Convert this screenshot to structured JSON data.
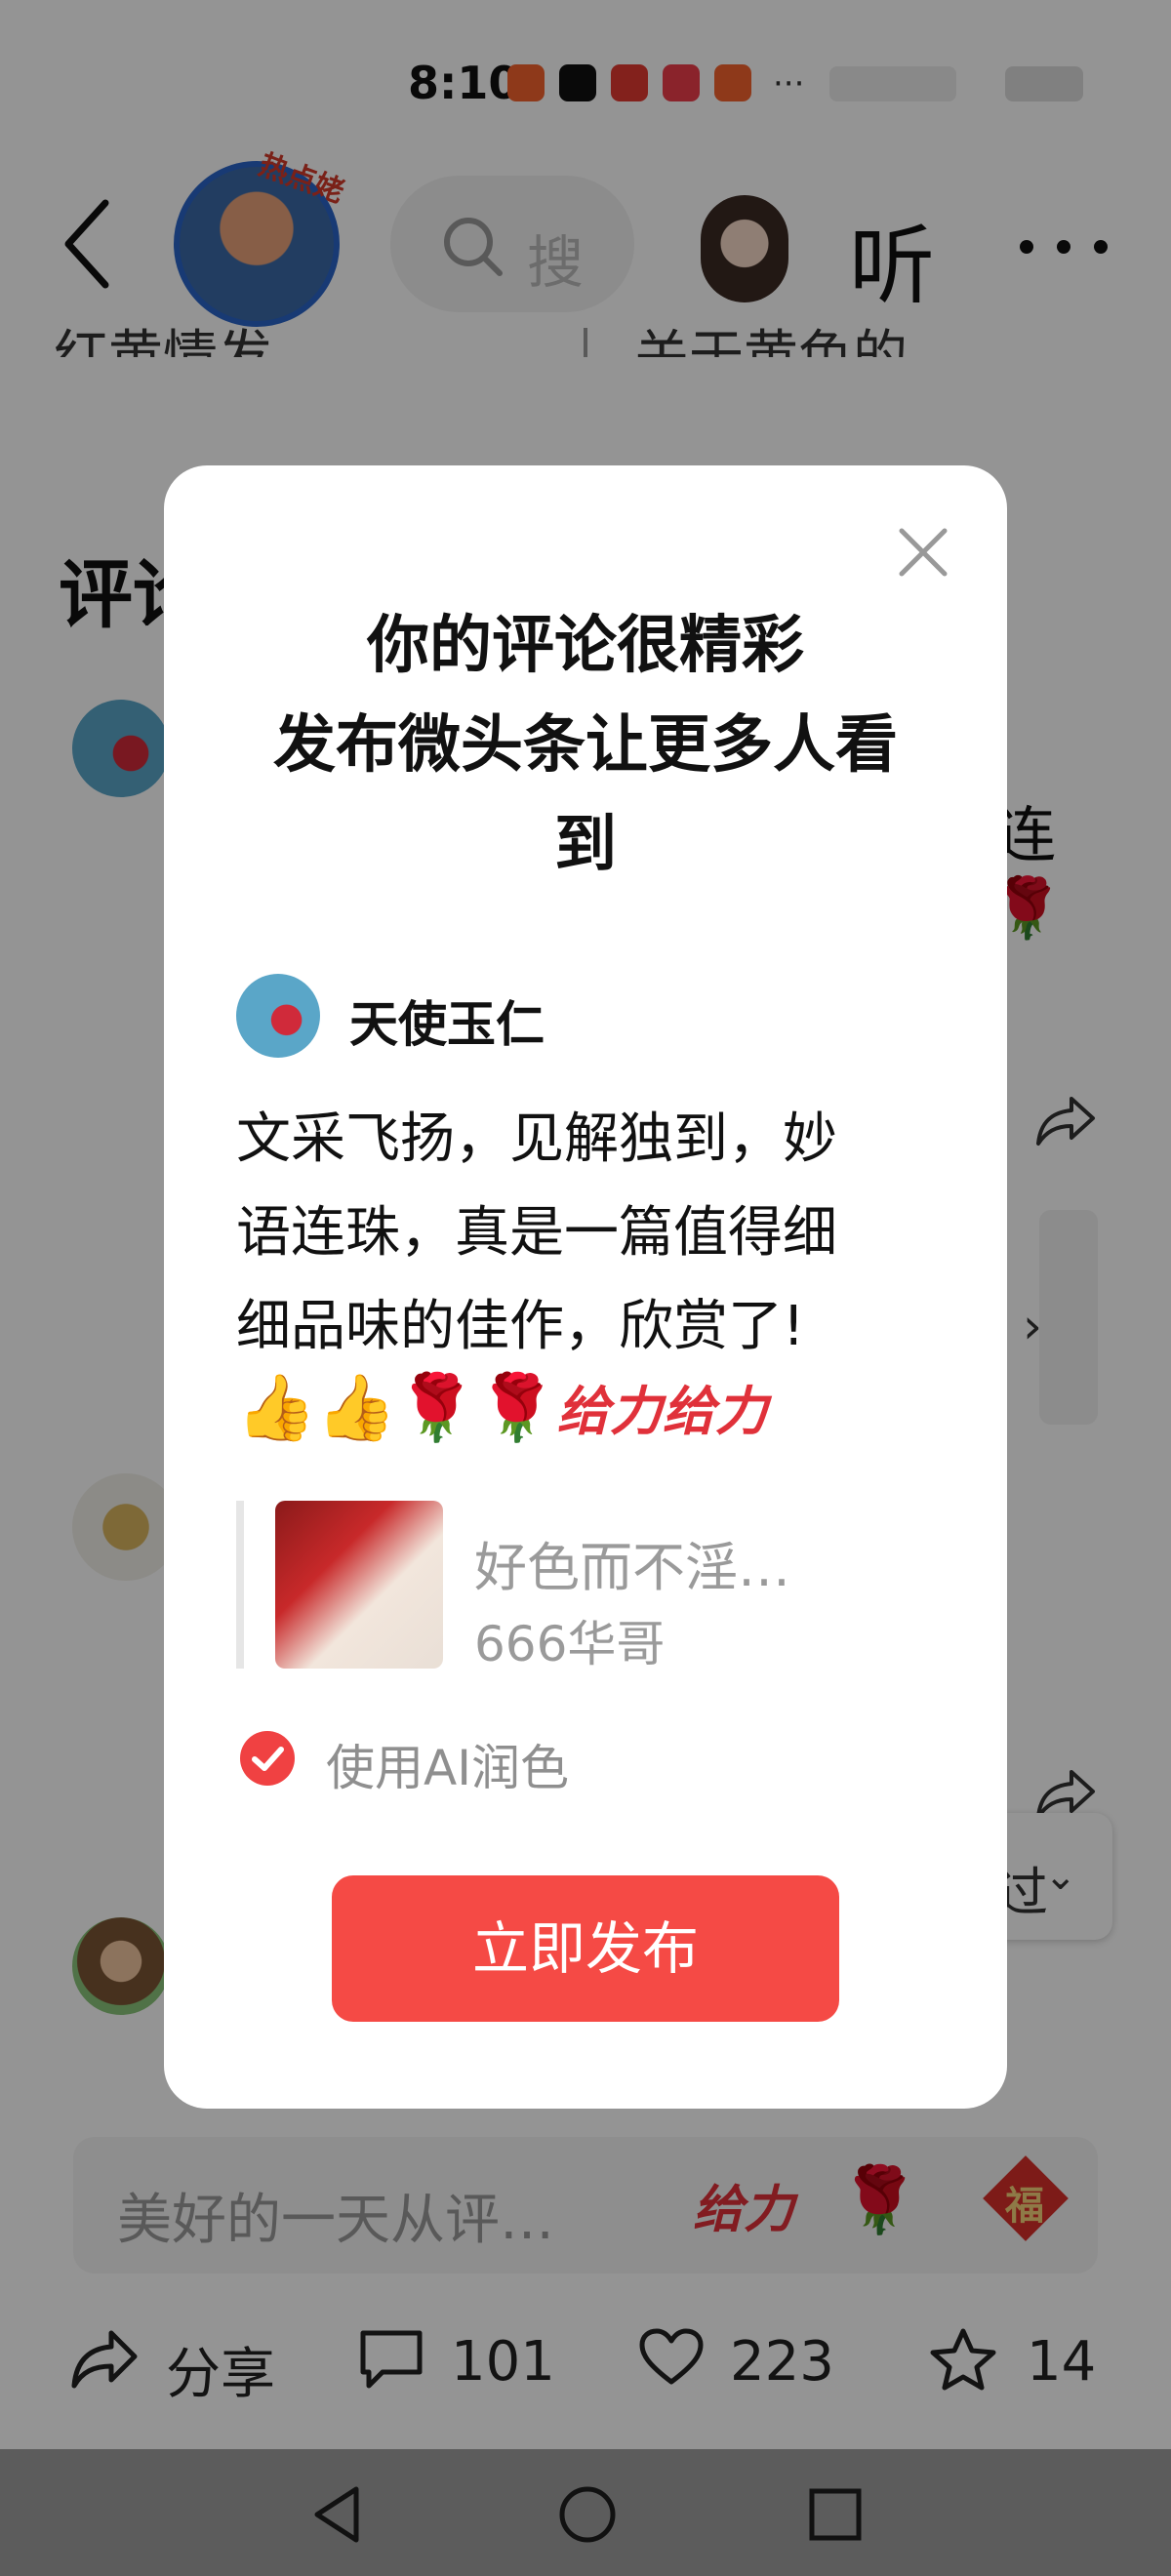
{
  "status_bar": {
    "time": "8:10",
    "more": "···"
  },
  "header": {
    "hot_badge": "热点姥",
    "search_text": "搜",
    "listen_label": "听"
  },
  "background": {
    "cut_text_left": "红黄情发",
    "cut_text_right": "关于黄色的…",
    "comments_title": "评论",
    "peek_text": "连",
    "floating_text": "过"
  },
  "comment_input": {
    "placeholder": "美好的一天从评…",
    "sticker_gei": "给力",
    "sticker_fu": "福"
  },
  "actions": [
    {
      "icon": "share-icon",
      "label": "分享"
    },
    {
      "icon": "comment-icon",
      "label": "101"
    },
    {
      "icon": "heart-icon",
      "label": "223"
    },
    {
      "icon": "star-icon",
      "label": "14"
    }
  ],
  "dialog": {
    "title_lines": [
      "你的评论很精彩",
      "发布微头条让更多人看",
      "到"
    ],
    "username": "天使玉仁",
    "body_lines": [
      "文采飞扬，见解独到，妙",
      "语连珠，真是一篇值得细",
      "细品味的佳作，欣赏了!"
    ],
    "emoji": {
      "thumbs": "👍",
      "rose": "🌹",
      "gei": "给力"
    },
    "quote": {
      "title": "好色而不淫…",
      "author": "666华哥"
    },
    "ai_option": {
      "label": "使用AI润色",
      "checked": true
    },
    "publish_label": "立即发布"
  },
  "colors": {
    "accent": "#f54a45",
    "check": "#f04142",
    "overlay": "rgba(0,0,0,0.42)",
    "navbar": "#5c5c5c"
  }
}
